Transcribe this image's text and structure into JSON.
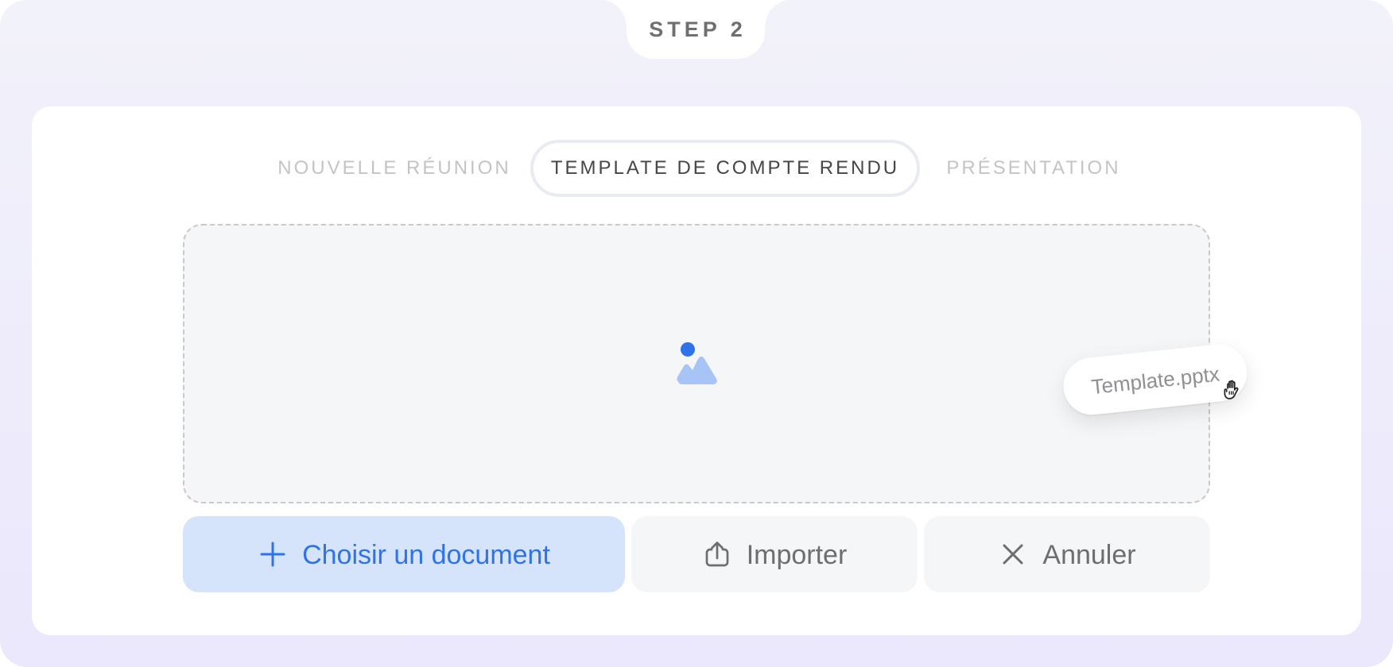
{
  "header": {
    "step_label": "STEP 2"
  },
  "tabs": [
    {
      "label": "NOUVELLE RÉUNION",
      "state": "inactive"
    },
    {
      "label": "TEMPLATE DE COMPTE RENDU",
      "state": "active"
    },
    {
      "label": "PRÉSENTATION",
      "state": "inactive"
    }
  ],
  "dropzone": {
    "center_icon": "image-icon",
    "dragged_file": {
      "name": "Template.pptx",
      "cursor_icon": "grab-hand-icon"
    }
  },
  "actions": [
    {
      "label": "Choisir un document",
      "icon": "plus-icon",
      "style": "primary"
    },
    {
      "label": "Importer",
      "icon": "upload-icon",
      "style": "secondary"
    },
    {
      "label": "Annuler",
      "icon": "close-icon",
      "style": "secondary"
    }
  ],
  "colors": {
    "accent": "#2E74E8",
    "accent_soft": "#D5E3FB",
    "image_light": "#A8C4F7",
    "background_top": "#F2F2FA",
    "background_bottom": "#EBE7FC",
    "muted_text": "#C4C4C8",
    "dark_text": "#46464A",
    "secondary_button": "#F5F6F8"
  }
}
